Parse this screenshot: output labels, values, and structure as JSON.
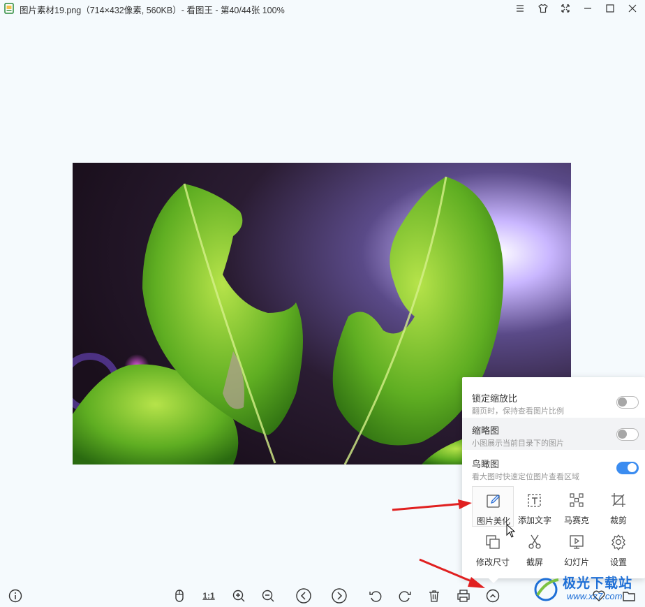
{
  "window": {
    "title": "图片素材19.png（714×432像素, 560KB）- 看图王 - 第40/44张 100%"
  },
  "settings_popup": {
    "options": [
      {
        "title": "锁定缩放比",
        "desc": "翻页时，保持查看图片比例",
        "enabled": false
      },
      {
        "title": "缩略图",
        "desc": "小图展示当前目录下的图片",
        "enabled": false
      },
      {
        "title": "鸟瞰图",
        "desc": "看大图时快速定位图片查看区域",
        "enabled": true
      }
    ],
    "tools": [
      {
        "label": "图片美化",
        "icon": "edit-pencil-icon"
      },
      {
        "label": "添加文字",
        "icon": "add-text-icon"
      },
      {
        "label": "马赛克",
        "icon": "mosaic-icon"
      },
      {
        "label": "裁剪",
        "icon": "crop-icon"
      },
      {
        "label": "修改尺寸",
        "icon": "resize-icon"
      },
      {
        "label": "截屏",
        "icon": "scissors-icon"
      },
      {
        "label": "幻灯片",
        "icon": "slideshow-icon"
      },
      {
        "label": "设置",
        "icon": "gear-icon"
      }
    ]
  },
  "toolbar": {
    "actual_size_label": "1:1"
  },
  "watermark": {
    "name": "极光下载站",
    "url": "www.xz7.com"
  },
  "colors": {
    "background": "#f5fafd",
    "toggle_on": "#3b8cf0",
    "arrow": "#e02020",
    "watermark": "#1e6fd6"
  }
}
